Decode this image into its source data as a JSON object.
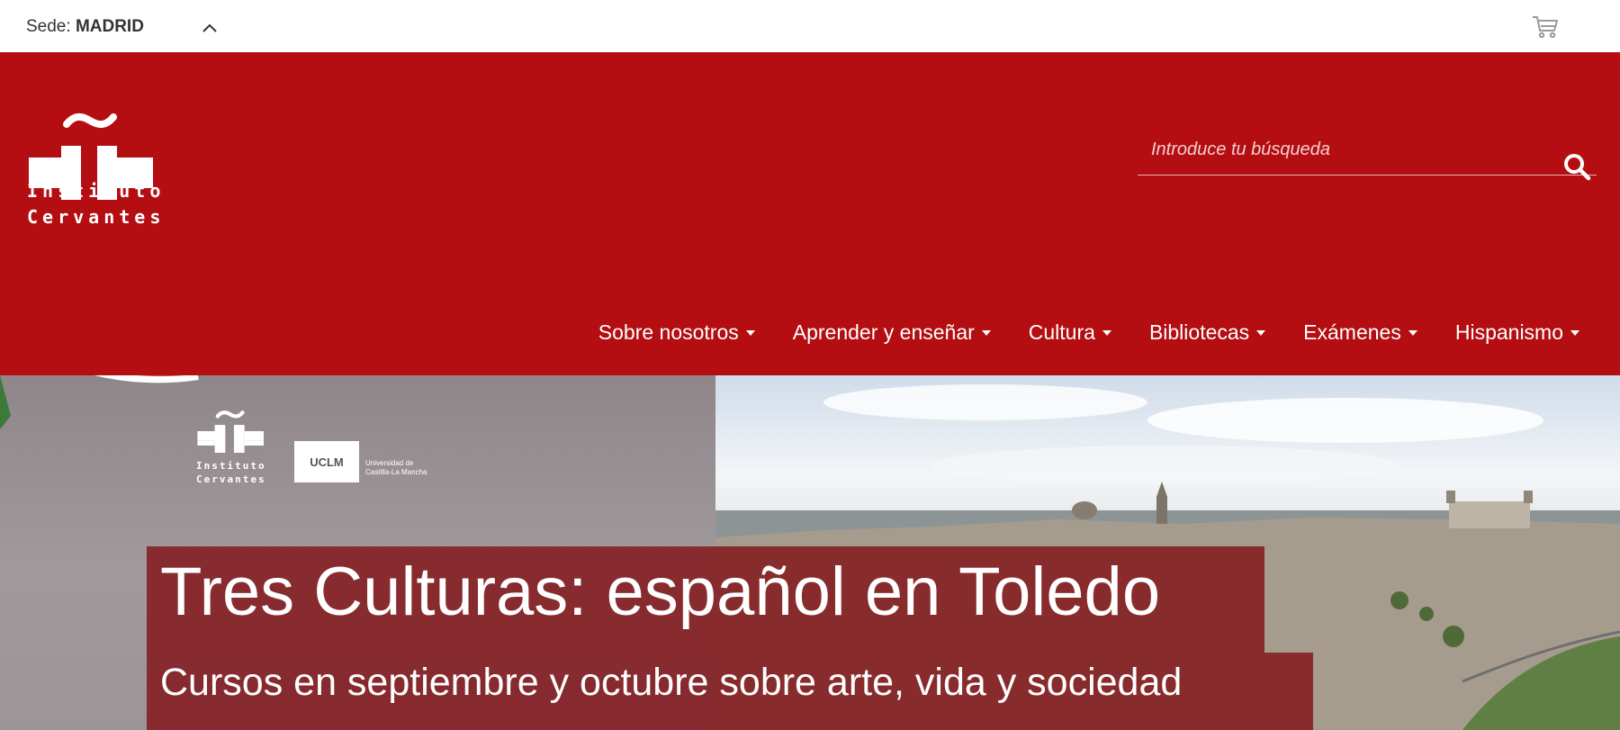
{
  "topbar": {
    "sede_prefix": "Sede: ",
    "sede_value": "MADRID",
    "chevron_icon": "chevron-up-icon",
    "cart_icon": "cart-icon"
  },
  "header": {
    "brand_color": "#b40e12",
    "logo_line1": "Instituto",
    "logo_line2": "Cervantes",
    "search": {
      "placeholder": "Introduce tu búsqueda",
      "icon": "search-icon"
    },
    "nav": [
      {
        "label": "Sobre nosotros"
      },
      {
        "label": "Aprender y enseñar"
      },
      {
        "label": "Cultura"
      },
      {
        "label": "Bibliotecas"
      },
      {
        "label": "Exámenes"
      },
      {
        "label": "Hispanismo"
      }
    ]
  },
  "hero": {
    "title": "Tres Culturas: español en Toledo",
    "subtitle": "Cursos en septiembre y octubre sobre arte, vida y sociedad",
    "logo_line1": "Instituto",
    "logo_line2": "Cervantes",
    "partner_logo": "UCLM",
    "partner_caption_1": "Universidad de",
    "partner_caption_2": "Castilla-La Mancha"
  }
}
